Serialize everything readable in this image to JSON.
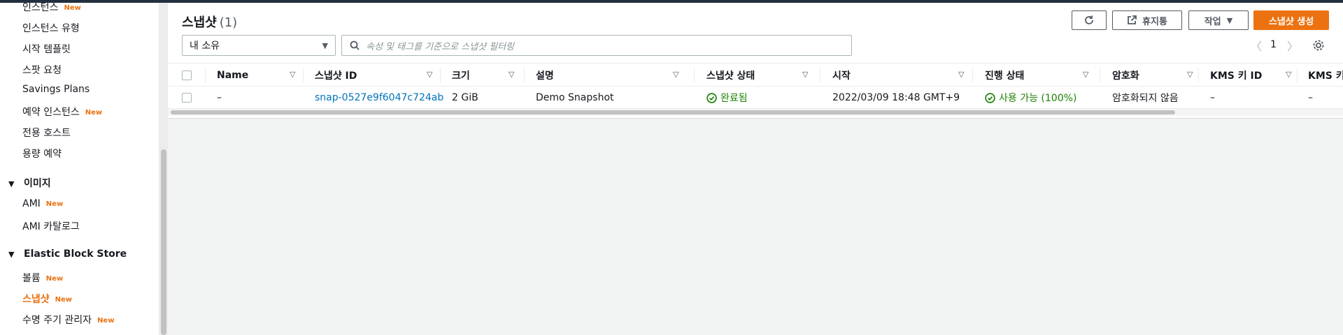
{
  "sidebar": {
    "top_items": [
      {
        "label": "인스턴스",
        "new": "New"
      },
      {
        "label": "인스턴스 유형"
      },
      {
        "label": "시작 템플릿"
      },
      {
        "label": "스팟 요청"
      },
      {
        "label": "Savings Plans"
      },
      {
        "label": "예약 인스턴스",
        "new": "New"
      },
      {
        "label": "전용 호스트"
      },
      {
        "label": "용량 예약"
      }
    ],
    "images_section": {
      "title": "이미지",
      "items": [
        {
          "label": "AMI",
          "new": "New"
        },
        {
          "label": "AMI 카탈로그"
        }
      ]
    },
    "ebs_section": {
      "title": "Elastic Block Store",
      "items": [
        {
          "label": "볼륨",
          "new": "New"
        },
        {
          "label": "스냅샷",
          "new": "New"
        },
        {
          "label": "수명 주기 관리자",
          "new": "New"
        }
      ]
    }
  },
  "header": {
    "title": "스냅샷",
    "count": "(1)",
    "recycle_bin_label": "휴지통",
    "actions_label": "작업",
    "create_label": "스냅샷 생성"
  },
  "filters": {
    "ownership_selected": "내 소유",
    "search_placeholder": "속성 및 태그를 기준으로 스냅샷 필터링"
  },
  "pagination": {
    "current_page": "1"
  },
  "table": {
    "columns": [
      "Name",
      "스냅샷 ID",
      "크기",
      "설명",
      "스냅샷 상태",
      "시작",
      "진행 상태",
      "암호화",
      "KMS 키 ID",
      "KMS 키"
    ],
    "rows": [
      {
        "name": "–",
        "snapshot_id": "snap-0527e9f6047c724ab",
        "size": "2 GiB",
        "description": "Demo Snapshot",
        "state": "완료됨",
        "started": "2022/03/09 18:48 GMT+9",
        "progress": "사용 가능 (100%)",
        "encryption": "암호화되지 않음",
        "kms_key_id": "–",
        "kms_key": "–"
      }
    ]
  },
  "colors": {
    "accent": "#ec7211",
    "link": "#0073bb",
    "success": "#1d8102"
  }
}
